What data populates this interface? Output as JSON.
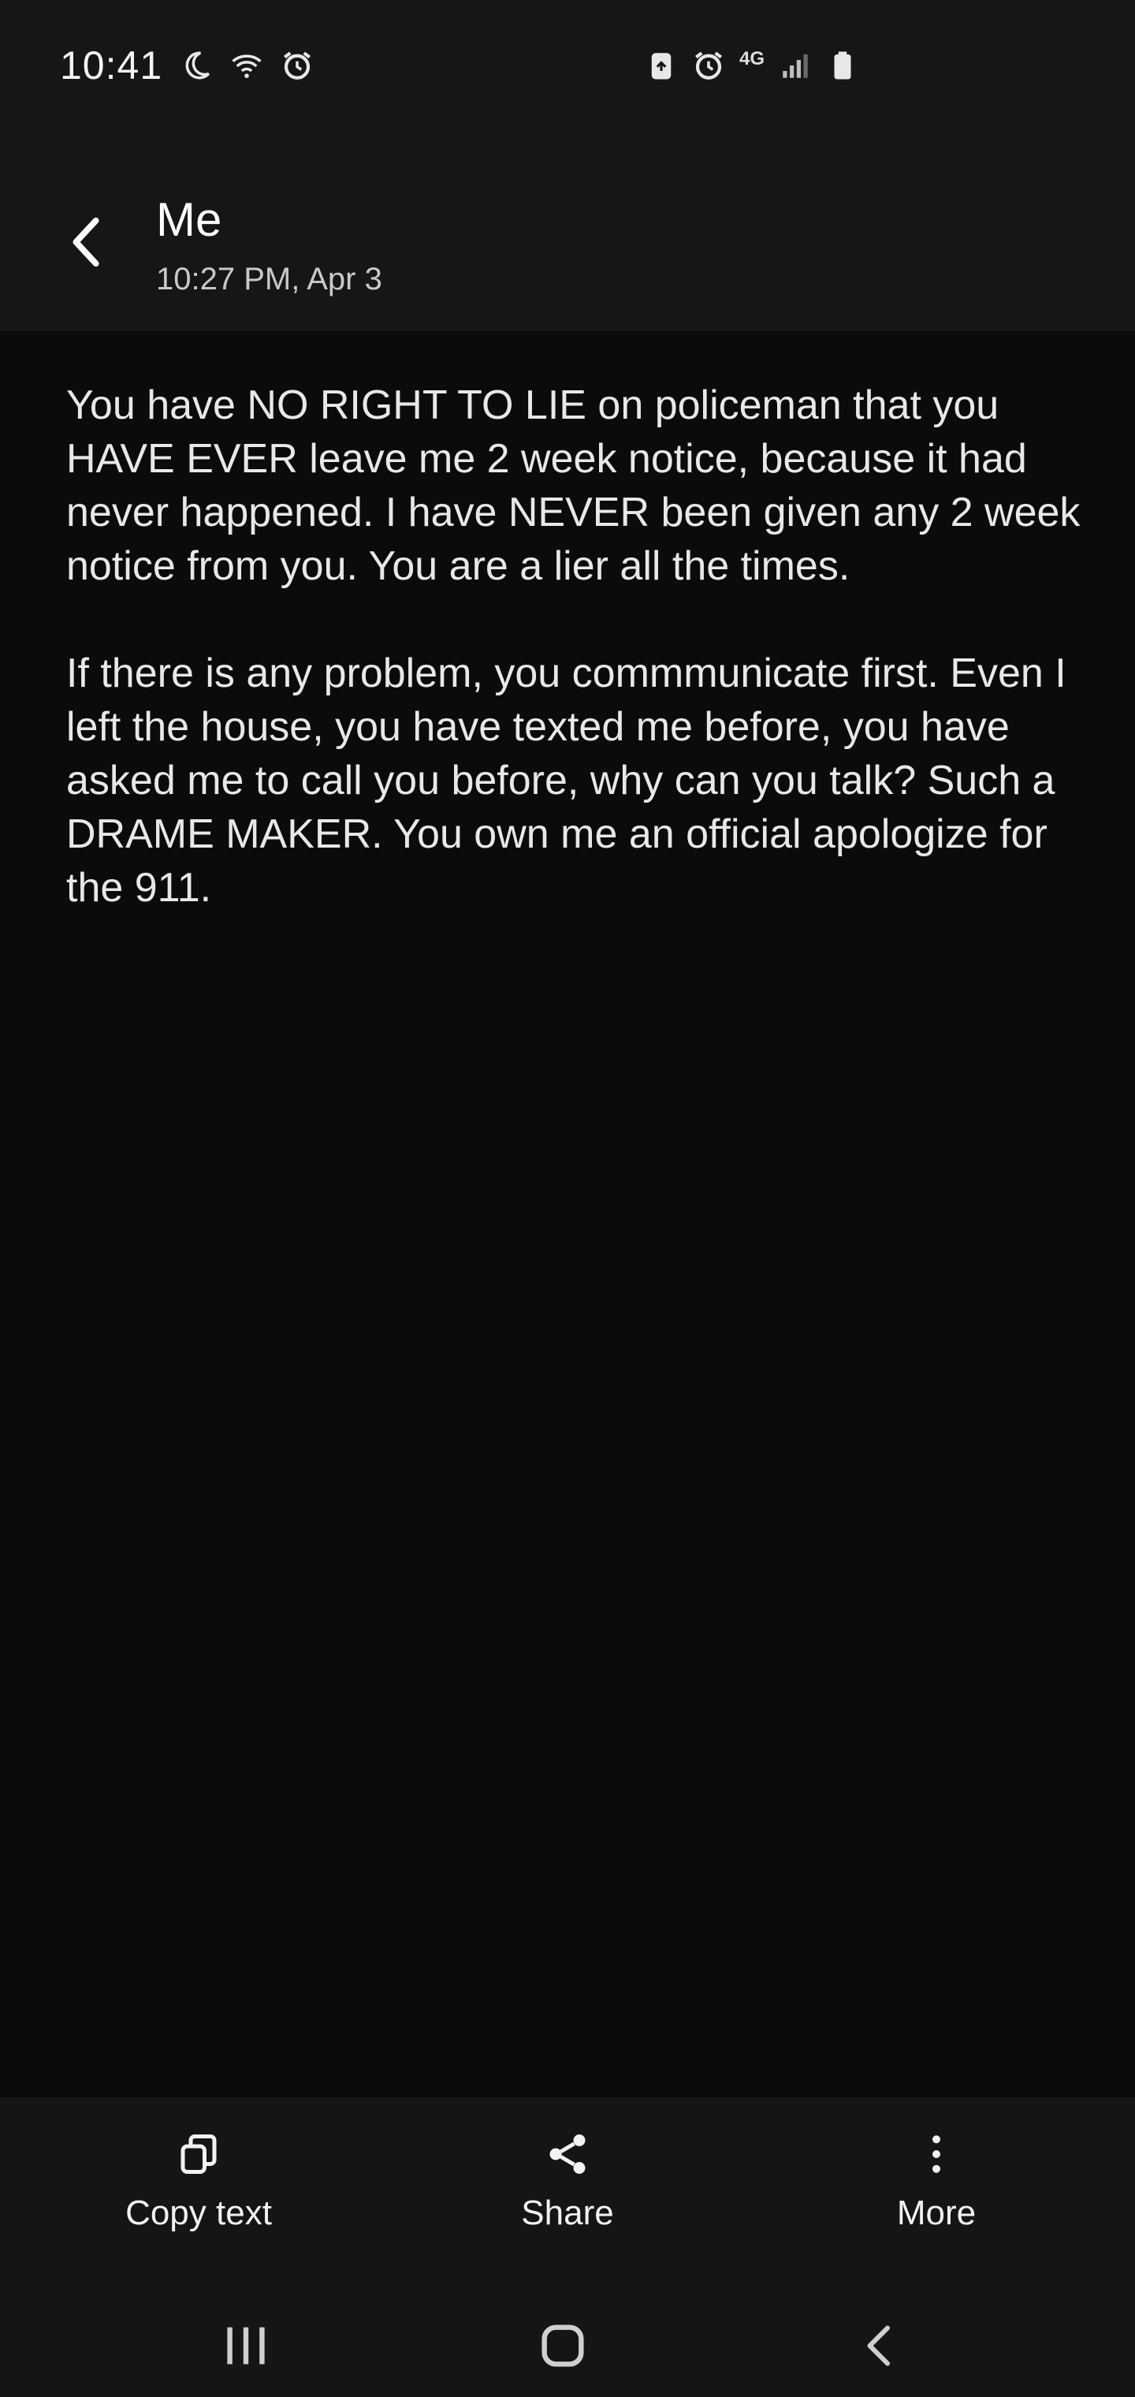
{
  "status_bar": {
    "time": "10:41",
    "network": "4G",
    "icons_left": [
      "moon-icon",
      "wifi-icon",
      "alarm-icon"
    ],
    "icons_right": [
      "battery-saver-icon",
      "alarm-icon",
      "lte-icon",
      "signal-icon",
      "battery-icon"
    ]
  },
  "header": {
    "title": "Me",
    "subtitle": "10:27 PM, Apr 3",
    "back_icon": "chevron-left-icon"
  },
  "message": {
    "paragraphs": [
      "You have NO RIGHT TO LIE on policeman that you HAVE EVER leave me 2 week notice, because it had never happened. I have NEVER been given any 2 week notice from you. You are a lier all the times.",
      "If there is any problem, you commmunicate first. Even I left the house, you have texted me before, you have asked me to call you before, why can you talk? Such a DRAME MAKER. You own me an official apologize for the 911."
    ]
  },
  "actions": [
    {
      "label": "Copy text",
      "icon": "copy-icon"
    },
    {
      "label": "Share",
      "icon": "share-icon"
    },
    {
      "label": "More",
      "icon": "more-vertical-icon"
    }
  ],
  "nav": {
    "recents_icon": "recents-icon",
    "home_icon": "home-icon",
    "back_icon": "back-icon"
  },
  "colors": {
    "background": "#0b0b0b",
    "header_background": "#161616",
    "text": "#e8e8e8",
    "subtext": "#c9c9c9"
  }
}
